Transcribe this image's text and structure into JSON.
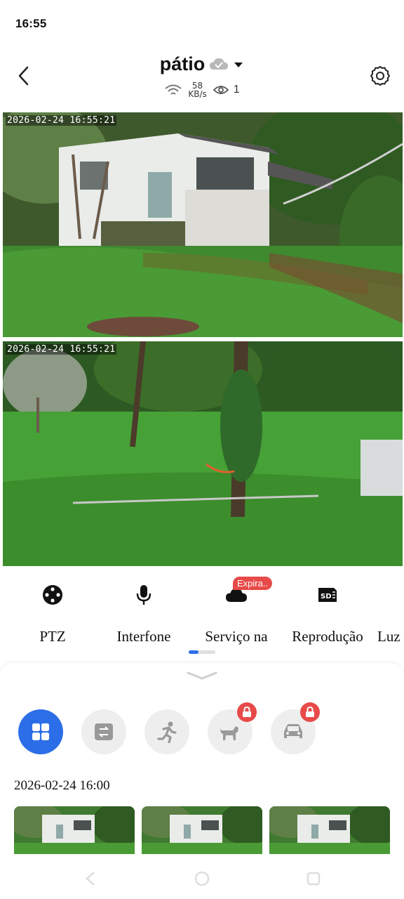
{
  "status_bar": {
    "time": "16:55"
  },
  "header": {
    "title": "pátio",
    "speed_value": "58",
    "speed_unit": "KB/s",
    "viewer_count": "1"
  },
  "feeds": [
    {
      "timestamp": "2026-02-24 16:55:21"
    },
    {
      "timestamp": "2026-02-24 16:55:21"
    }
  ],
  "toolbar": {
    "items": [
      {
        "label": "PTZ",
        "icon": "ptz-joystick-icon"
      },
      {
        "label": "Interfone",
        "icon": "microphone-icon"
      },
      {
        "label": "Serviço na",
        "icon": "cloud-icon",
        "badge": "Expira.."
      },
      {
        "label": "Reprodução",
        "icon": "sd-card-icon"
      },
      {
        "label": "Luz",
        "icon": "light-icon"
      }
    ],
    "page_indicator": {
      "pages": 2,
      "current": 1
    }
  },
  "event_filters": [
    {
      "name": "all-events",
      "icon": "grid-icon",
      "active": true,
      "locked": false
    },
    {
      "name": "motion-change",
      "icon": "frame-switch-icon",
      "active": false,
      "locked": false
    },
    {
      "name": "person",
      "icon": "running-person-icon",
      "active": false,
      "locked": false
    },
    {
      "name": "pet",
      "icon": "dog-icon",
      "active": false,
      "locked": true
    },
    {
      "name": "vehicle",
      "icon": "car-icon",
      "active": false,
      "locked": true
    }
  ],
  "recordings": {
    "date_label": "2026-02-24 16:00",
    "thumbnail_count": 3
  },
  "colors": {
    "accent": "#2b6ee8",
    "badge_red": "#e84a4a",
    "filter_bg": "#eeeeee"
  }
}
